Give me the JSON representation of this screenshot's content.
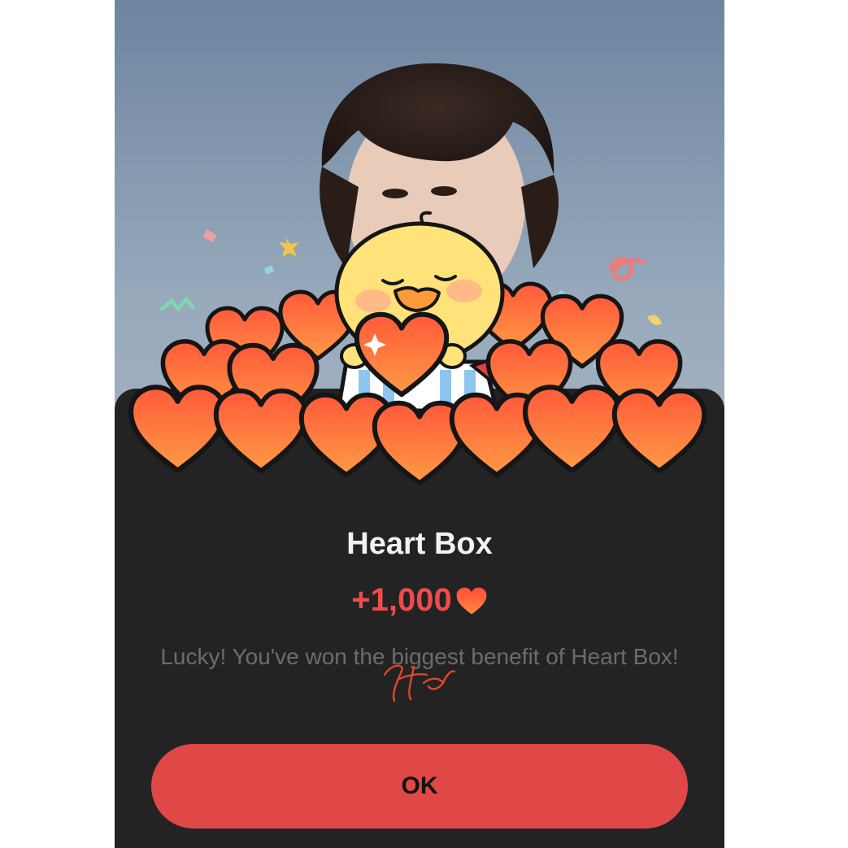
{
  "dialog": {
    "title": "Heart Box",
    "reward_amount": "+1,000",
    "reward_icon": "heart-icon",
    "message": "Lucky! You've won the biggest benefit of Heart Box!",
    "ok_label": "OK"
  },
  "colors": {
    "sheet_bg": "#232323",
    "accent_red": "#ef4b4b",
    "button_red": "#e04848",
    "heart_orange": "#ff7a3d",
    "chick_yellow": "#ffe27a"
  }
}
